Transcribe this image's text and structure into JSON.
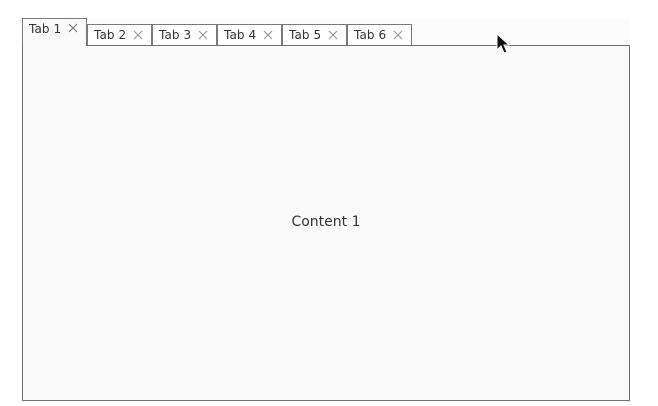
{
  "tabs": [
    {
      "label": "Tab 1",
      "active": true
    },
    {
      "label": "Tab 2",
      "active": false
    },
    {
      "label": "Tab 3",
      "active": false
    },
    {
      "label": "Tab 4",
      "active": false
    },
    {
      "label": "Tab 5",
      "active": false
    },
    {
      "label": "Tab 6",
      "active": false
    }
  ],
  "content": {
    "text": "Content 1"
  },
  "icons": {
    "close": "close-icon",
    "cursor": "mouse-pointer-icon"
  },
  "colors": {
    "panel_bg": "#fafafa",
    "border": "#6f6f6f",
    "text": "#333333",
    "close_icon": "#9a9a9a"
  }
}
